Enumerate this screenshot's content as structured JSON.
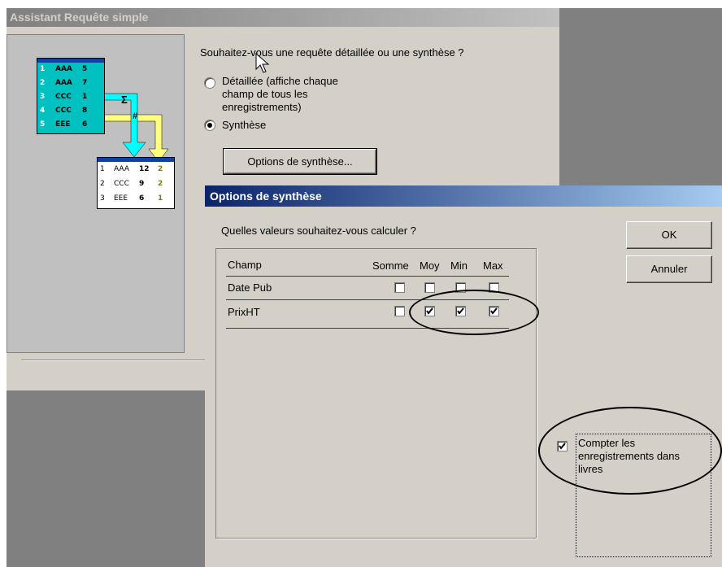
{
  "wizard": {
    "title": "Assistant Requête simple",
    "question": "Souhaitez-vous une requête détaillée ou une synthèse ?",
    "option_detail": "Détaillée (affiche chaque champ de tous les enregistrements)",
    "option_summary": "Synthèse",
    "summary_options_button": "Options de synthèse..."
  },
  "illustration": {
    "source_rows": [
      {
        "n": "1",
        "k": "AAA",
        "v": "5"
      },
      {
        "n": "2",
        "k": "AAA",
        "v": "7"
      },
      {
        "n": "3",
        "k": "CCC",
        "v": "1"
      },
      {
        "n": "4",
        "k": "CCC",
        "v": "8"
      },
      {
        "n": "5",
        "k": "EEE",
        "v": "6"
      }
    ],
    "sigma": "Σ",
    "hash": "#",
    "result_rows": [
      {
        "n": "1",
        "k": "AAA",
        "s": "12",
        "c": "2"
      },
      {
        "n": "2",
        "k": "CCC",
        "s": "9",
        "c": "2"
      },
      {
        "n": "3",
        "k": "EEE",
        "s": "6",
        "c": "1"
      }
    ]
  },
  "dialog": {
    "title": "Options de synthèse",
    "question": "Quelles valeurs souhaitez-vous calculer ?",
    "ok_button": "OK",
    "cancel_button": "Annuler",
    "columns": [
      "Champ",
      "Somme",
      "Moy",
      "Min",
      "Max"
    ],
    "rows": [
      {
        "field": "Date Pub",
        "somme": false,
        "moy": false,
        "min": false,
        "max": false
      },
      {
        "field": "PrixHT",
        "somme": false,
        "moy": true,
        "min": true,
        "max": true
      }
    ],
    "count_records_label": "Compter les enregistrements dans livres",
    "count_records_checked": true
  }
}
